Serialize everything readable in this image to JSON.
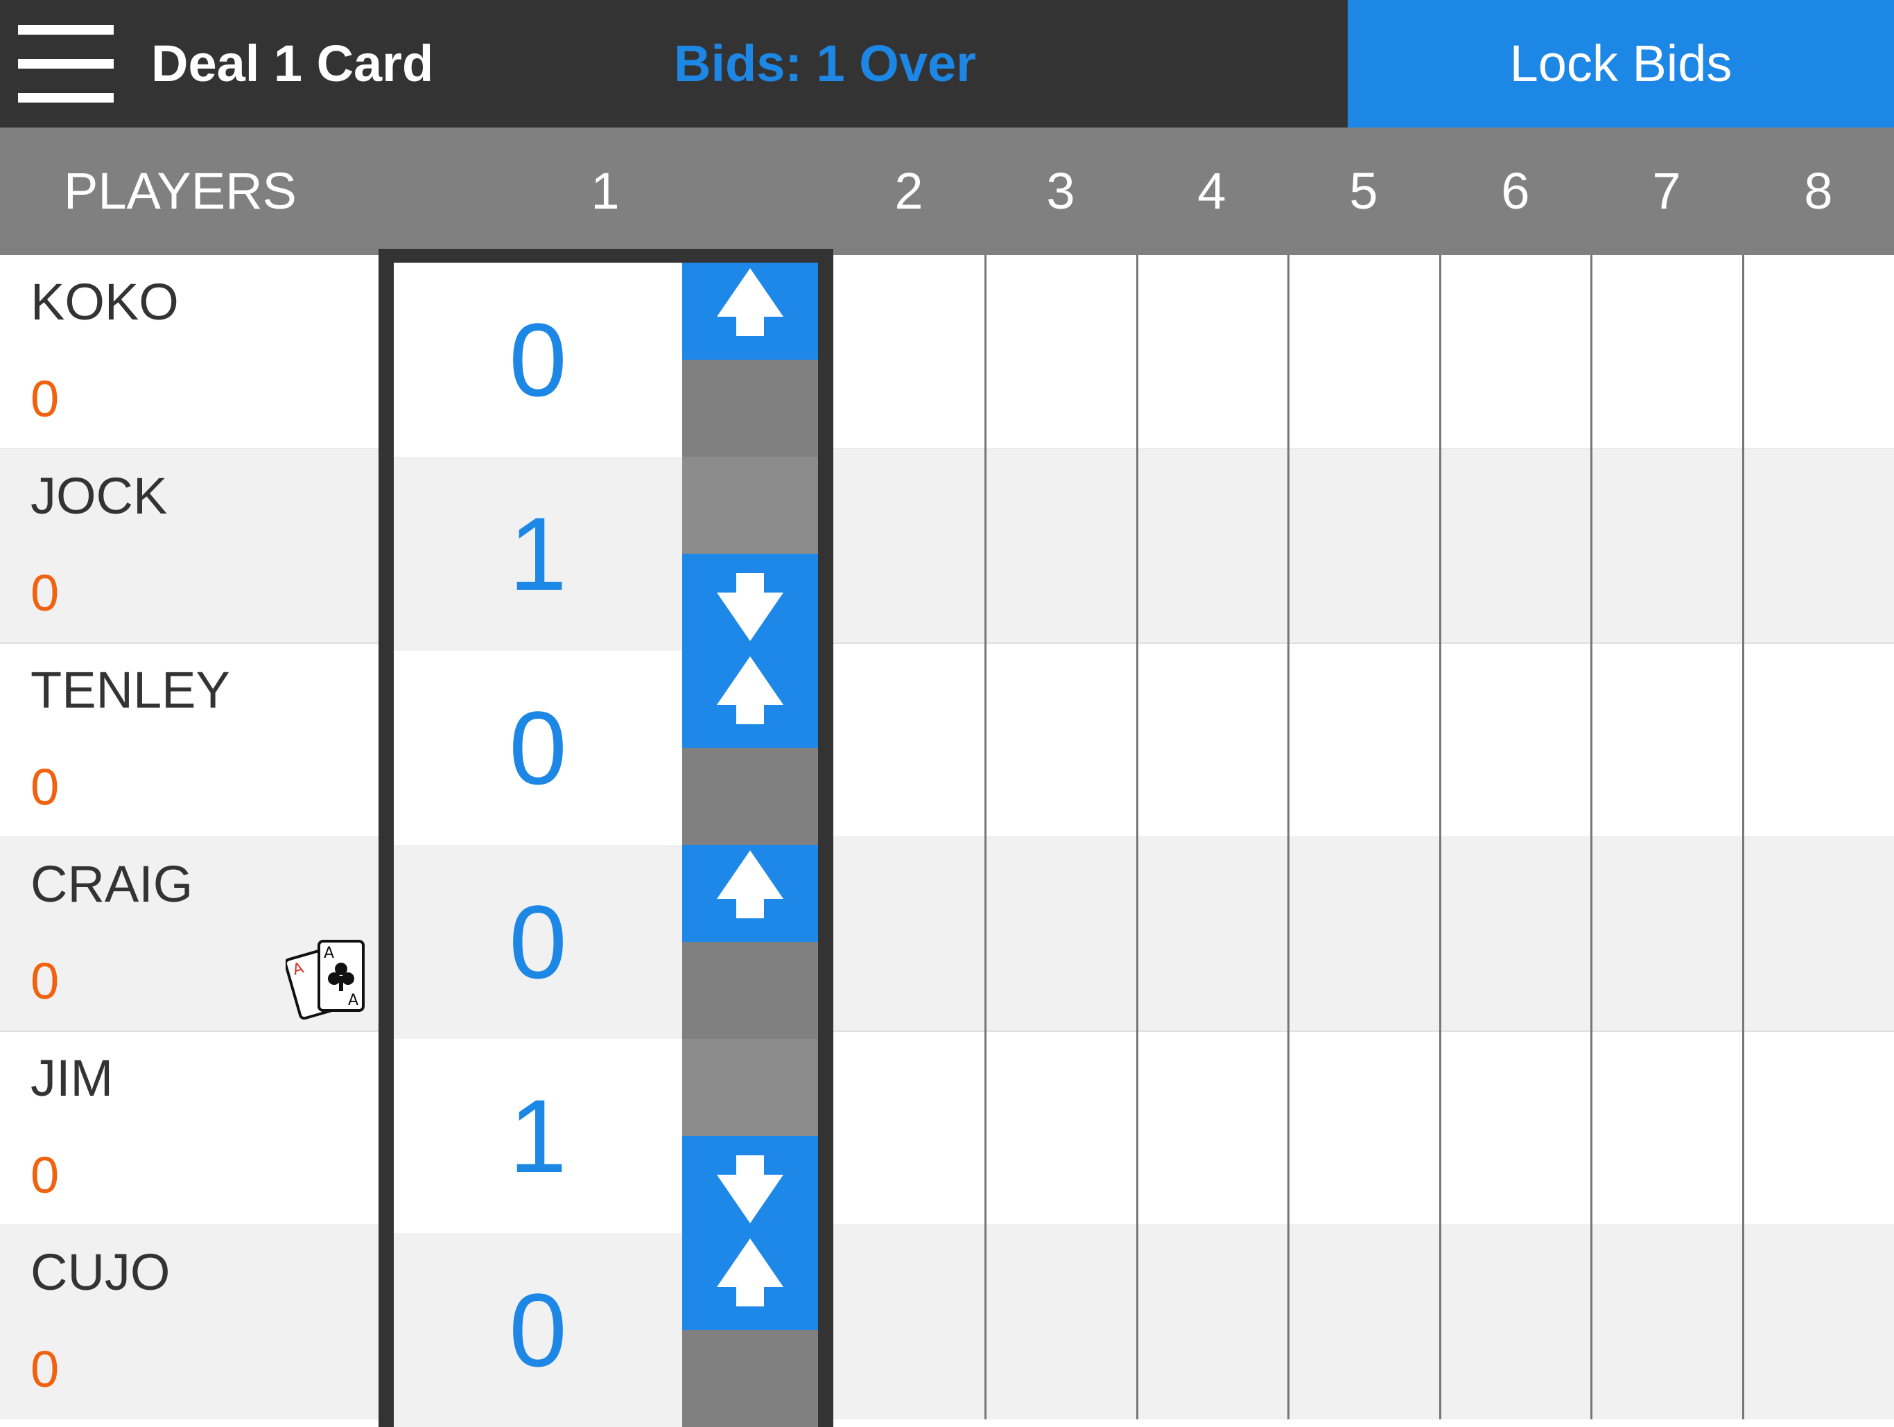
{
  "topbar": {
    "deal_title": "Deal 1 Card",
    "bids_status": "Bids: 1 Over",
    "lock_bids_label": "Lock Bids"
  },
  "header": {
    "players_label": "PLAYERS",
    "rounds": [
      "1",
      "2",
      "3",
      "4",
      "5",
      "6",
      "7",
      "8"
    ]
  },
  "players": [
    {
      "name": "KOKO",
      "score": "0",
      "bid": "0",
      "up_enabled": true,
      "down_enabled": false
    },
    {
      "name": "JOCK",
      "score": "0",
      "bid": "1",
      "up_enabled": false,
      "down_enabled": true
    },
    {
      "name": "TENLEY",
      "score": "0",
      "bid": "0",
      "up_enabled": true,
      "down_enabled": false
    },
    {
      "name": "CRAIG",
      "score": "0",
      "bid": "0",
      "up_enabled": true,
      "down_enabled": false,
      "dealer": true
    },
    {
      "name": "JIM",
      "score": "0",
      "bid": "1",
      "up_enabled": false,
      "down_enabled": true
    },
    {
      "name": "CUJO",
      "score": "0",
      "bid": "0",
      "up_enabled": true,
      "down_enabled": false
    }
  ],
  "dealer_icon": {
    "name": "playing-cards-icon",
    "card_letter": "A"
  },
  "colors": {
    "accent": "#1d87e6",
    "score": "#f0620f",
    "bar": "#333333",
    "header": "#808080"
  }
}
